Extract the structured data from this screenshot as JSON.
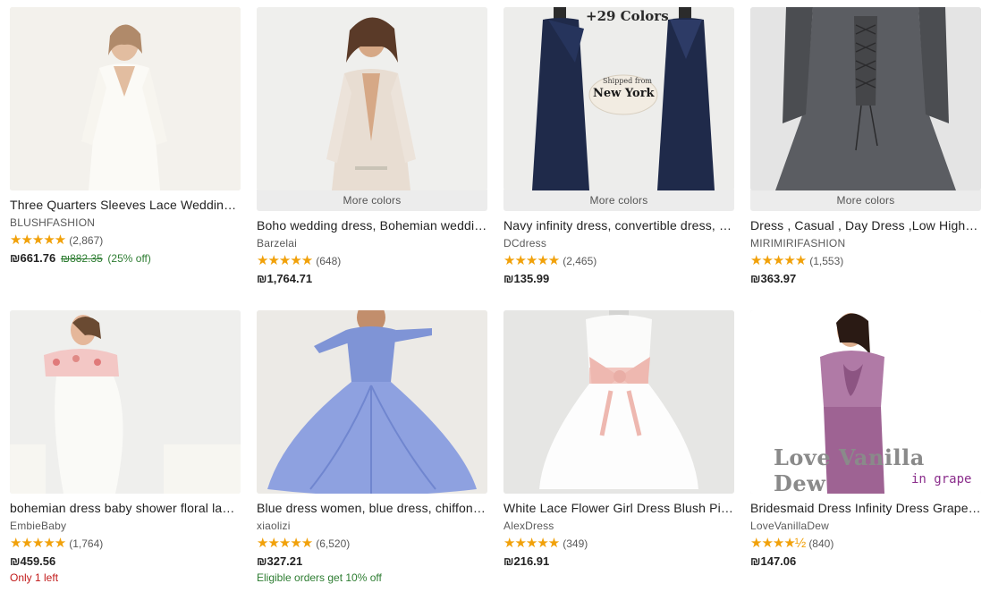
{
  "listings": [
    {
      "title": "Three Quarters Sleeves Lace Wedding Dress with V-Neck",
      "shop": "BLUSHFASHION",
      "stars": "★★★★★",
      "reviews": "(2,867)",
      "price": "₪661.76",
      "original_price": "₪882.35",
      "discount": "(25% off)",
      "more_colors": "",
      "note": "",
      "image_icon": "white-lace-dress-photo"
    },
    {
      "title": "Boho wedding dress, Bohemian wedding dress",
      "shop": "Barzelai",
      "stars": "★★★★★",
      "reviews": "(648)",
      "price": "₪1,764.71",
      "original_price": "",
      "discount": "",
      "more_colors": "More colors",
      "note": "",
      "image_icon": "boho-dress-photo"
    },
    {
      "title": "Navy infinity dress, convertible dress, multiway dress",
      "shop": "DCdress",
      "stars": "★★★★★",
      "reviews": "(2,465)",
      "price": "₪135.99",
      "original_price": "",
      "discount": "",
      "more_colors": "More colors",
      "note": "",
      "image_icon": "navy-dress-photo",
      "overlay_colors": "+29 Colors",
      "overlay_shipped": "Shipped from",
      "overlay_city": "New York"
    },
    {
      "title": "Dress , Casual , Day Dress ,Low High Dress",
      "shop": "MIRIMIRIFASHION",
      "stars": "★★★★★",
      "reviews": "(1,553)",
      "price": "₪363.97",
      "original_price": "",
      "discount": "",
      "more_colors": "More colors",
      "note": "",
      "image_icon": "gray-dress-photo"
    },
    {
      "title": "bohemian dress baby shower floral lace maternity dress",
      "shop": "EmbieBaby",
      "stars": "★★★★★",
      "reviews": "(1,764)",
      "price": "₪459.56",
      "original_price": "",
      "discount": "",
      "more_colors": "",
      "note": "Only 1 left",
      "note_color": "#c21b1b",
      "image_icon": "maternity-dress-photo"
    },
    {
      "title": "Blue dress women, blue dress, chiffon dress, midi dress",
      "shop": "xiaolizi",
      "stars": "★★★★★",
      "reviews": "(6,520)",
      "price": "₪327.21",
      "original_price": "",
      "discount": "",
      "more_colors": "",
      "note": "Eligible orders get 10% off",
      "note_color": "#2e7d32",
      "image_icon": "blue-chiffon-dress-photo"
    },
    {
      "title": "White Lace Flower Girl Dress Blush Pink Bow Tulle Dress",
      "shop": "AlexDress",
      "stars": "★★★★★",
      "reviews": "(349)",
      "price": "₪216.91",
      "original_price": "",
      "discount": "",
      "more_colors": "",
      "note": "",
      "image_icon": "flower-girl-dress-photo"
    },
    {
      "title": "Bridesmaid Dress Infinity Dress Grape Purple Convertible",
      "shop": "LoveVanillaDew",
      "stars": "★★★★½",
      "reviews": "(840)",
      "price": "₪147.06",
      "original_price": "",
      "discount": "",
      "more_colors": "",
      "note": "",
      "image_icon": "grape-dress-photo",
      "overlay_brand": "Love Vanilla Dew",
      "overlay_color": "in grape"
    }
  ],
  "colors": {
    "star": "#f1a10a",
    "sale_green": "#2e7d32",
    "stock_red": "#c21b1b",
    "more_colors_bg": "#ececec"
  }
}
